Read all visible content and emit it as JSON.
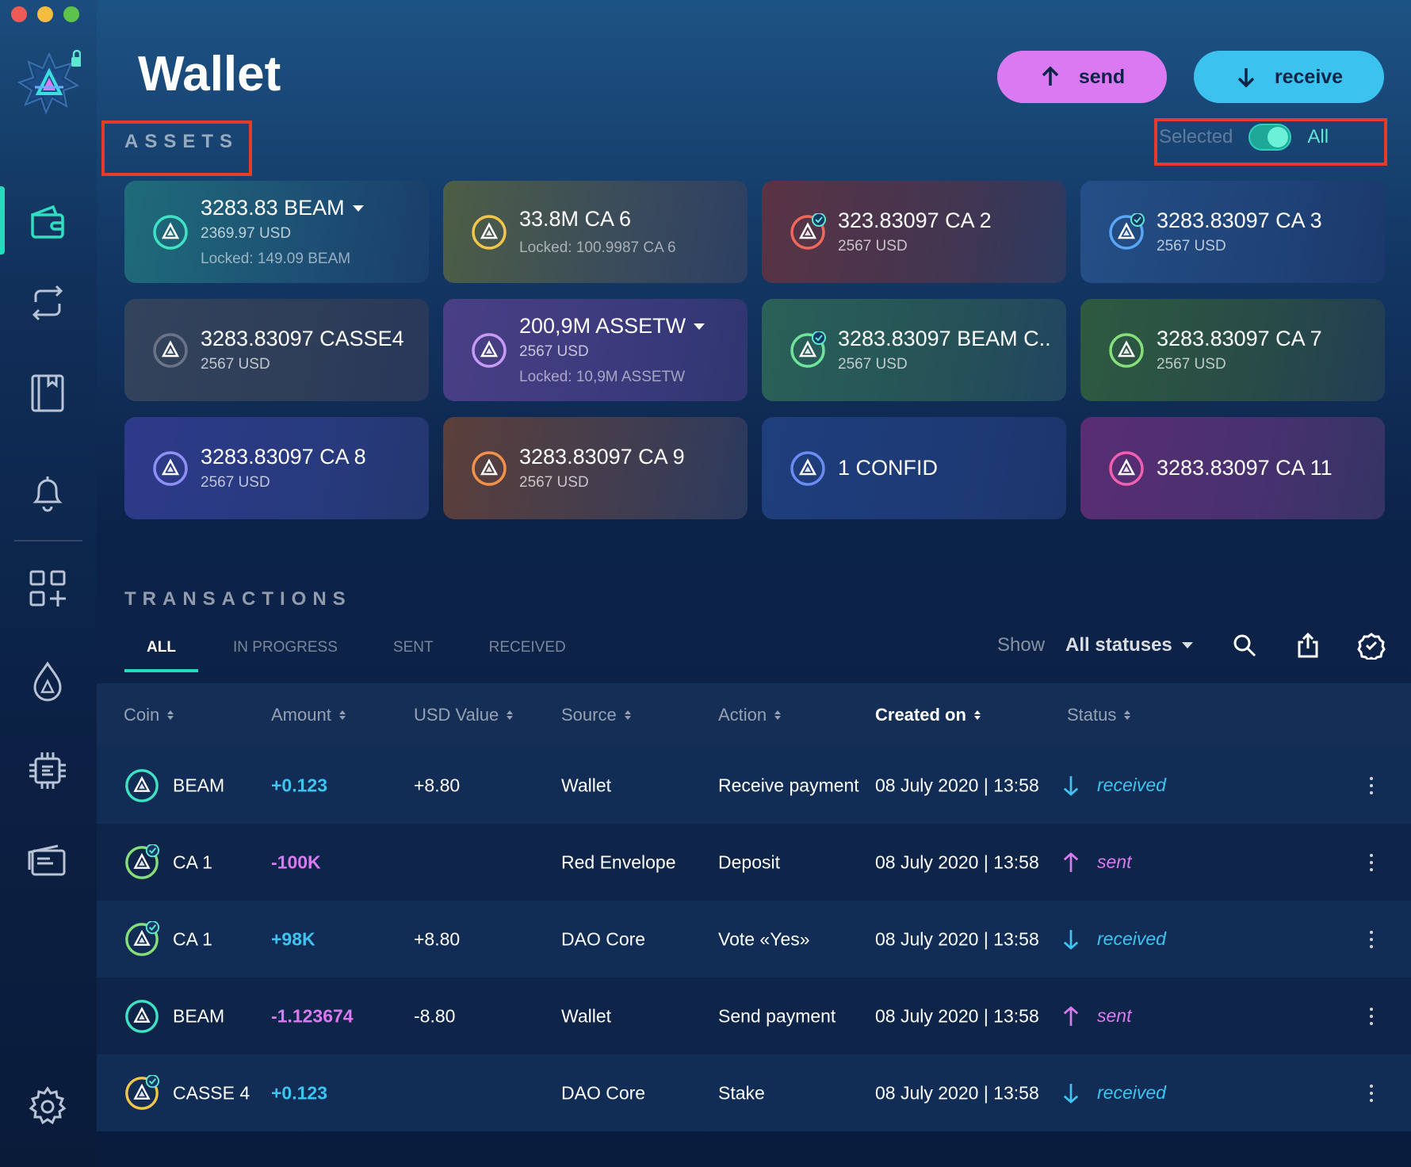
{
  "page": {
    "title": "Wallet"
  },
  "actions": {
    "send_label": "send",
    "receive_label": "receive"
  },
  "assets": {
    "section_label": "ASSETS",
    "toggle": {
      "selected_label": "Selected",
      "all_label": "All",
      "value": "All"
    },
    "cards": [
      {
        "amount": "3283.83 BEAM",
        "usd": "2369.97 USD",
        "locked": "Locked: 149.09 BEAM",
        "dropdown": true,
        "verified": false,
        "icon_color": "#3fe3c3",
        "bg": "linear-gradient(100deg,#1f6c7a 0%,#1d4f74 60%,#1a3e6a 100%)"
      },
      {
        "amount": "33.8M CA 6",
        "usd": "",
        "locked": "Locked: 100.9987 CA 6",
        "dropdown": false,
        "verified": false,
        "icon_color": "#f2c64b",
        "bg": "linear-gradient(100deg,#4d5e45 0%,#3a4b5c 60%,#2c3f62 100%)"
      },
      {
        "amount": "323.83097 CA 2",
        "usd": "2567 USD",
        "locked": "",
        "dropdown": false,
        "verified": true,
        "icon_color": "#f0685a",
        "bg": "linear-gradient(100deg,#5a3344 0%,#433550 60%,#2d3a60 100%)"
      },
      {
        "amount": "3283.83097 CA 3",
        "usd": "2567 USD",
        "locked": "",
        "dropdown": false,
        "verified": true,
        "icon_color": "#5aa6f5",
        "bg": "linear-gradient(100deg,#244f86 0%,#1f4378 60%,#1c386b 100%)"
      },
      {
        "amount": "3283.83097 CASSE4",
        "usd": "2567 USD",
        "locked": "",
        "dropdown": false,
        "verified": false,
        "icon_color": "#6a7486",
        "bg": "linear-gradient(100deg,#34435c 0%,#2e3d58 60%,#29375a 100%)"
      },
      {
        "amount": "200,9M ASSETW",
        "usd": "2567 USD",
        "locked": "Locked: 10,9M ASSETW",
        "dropdown": true,
        "verified": false,
        "icon_color": "#c79af5",
        "bg": "linear-gradient(100deg,#4a3f86 0%,#3b3a7c 60%,#2f3670 100%)"
      },
      {
        "amount": "3283.83097 BEAM C..",
        "usd": "2567 USD",
        "locked": "",
        "dropdown": false,
        "verified": true,
        "icon_color": "#6fe59a",
        "bg": "linear-gradient(100deg,#2a6158 0%,#265257 60%,#214560 100%)"
      },
      {
        "amount": "3283.83097 CA 7",
        "usd": "2567 USD",
        "locked": "",
        "dropdown": false,
        "verified": false,
        "icon_color": "#86e07a",
        "bg": "linear-gradient(100deg,#2e5a40 0%,#284b47 60%,#213d55 100%)"
      },
      {
        "amount": "3283.83097 CA 8",
        "usd": "2567 USD",
        "locked": "",
        "dropdown": false,
        "verified": false,
        "icon_color": "#8f8ff5",
        "bg": "linear-gradient(100deg,#2d3a8a 0%,#283a7e 60%,#243770 100%)"
      },
      {
        "amount": "3283.83097 CA 9",
        "usd": "2567 USD",
        "locked": "",
        "dropdown": false,
        "verified": false,
        "icon_color": "#f2924a",
        "bg": "linear-gradient(100deg,#5b3f3a 0%,#413d50 60%,#2b3a5e 100%)"
      },
      {
        "amount": "1 CONFID",
        "usd": "",
        "locked": "",
        "dropdown": false,
        "verified": false,
        "icon_color": "#6a8cf3",
        "bg": "linear-gradient(100deg,#1f3e7c 0%,#1e3a76 60%,#1c366c 100%)"
      },
      {
        "amount": "3283.83097 CA 11",
        "usd": "",
        "locked": "",
        "dropdown": false,
        "verified": false,
        "icon_color": "#f05fb0",
        "bg": "linear-gradient(100deg,#5a2d73 0%,#47316f 60%,#353464 100%)"
      }
    ]
  },
  "transactions": {
    "section_label": "TRANSACTIONS",
    "tabs": [
      "ALL",
      "IN PROGRESS",
      "SENT",
      "RECEIVED"
    ],
    "active_tab": "ALL",
    "filter": {
      "show_label": "Show",
      "status_value": "All statuses"
    },
    "columns": [
      "Coin",
      "Amount",
      "USD Value",
      "Source",
      "Action",
      "Created on",
      "Status"
    ],
    "sorted_column": "Created on",
    "rows": [
      {
        "coin": "BEAM",
        "coin_kind": "beam",
        "amount": "+0.123",
        "usd": "+8.80",
        "source": "Wallet",
        "action": "Receive payment",
        "created": "08 July 2020  | 13:58",
        "status": "received"
      },
      {
        "coin": "CA 1",
        "coin_kind": "ca-verified",
        "amount": "-100K",
        "usd": "",
        "source": "Red Envelope",
        "action": "Deposit",
        "created": "08 July 2020  | 13:58",
        "status": "sent"
      },
      {
        "coin": "CA 1",
        "coin_kind": "ca-verified",
        "amount": "+98K",
        "usd": "+8.80",
        "source": "DAO Core",
        "action": "Vote «Yes»",
        "created": "08 July 2020  | 13:58",
        "status": "received"
      },
      {
        "coin": "BEAM",
        "coin_kind": "beam",
        "amount": "-1.123674",
        "usd": "-8.80",
        "source": "Wallet",
        "action": "Send payment",
        "created": "08 July 2020  | 13:58",
        "status": "sent"
      },
      {
        "coin": "CASSE 4",
        "coin_kind": "casse-verified",
        "amount": "+0.123",
        "usd": "",
        "source": "DAO Core",
        "action": "Stake",
        "created": "08 July 2020  | 13:58",
        "status": "received"
      }
    ]
  },
  "colors": {
    "accent": "#25dbbd",
    "send": "#da79f1",
    "receive": "#3bc2ee",
    "highlight": "#e23d2b"
  },
  "icons": {
    "sidebar": [
      "wallet-icon",
      "swap-icon",
      "notebook-icon",
      "bell-icon",
      "dapps-add-icon",
      "faucet-icon",
      "chip-icon",
      "cards-icon",
      "gear-icon"
    ],
    "toolbar": [
      "search-icon",
      "export-icon",
      "verified-check-icon"
    ]
  }
}
